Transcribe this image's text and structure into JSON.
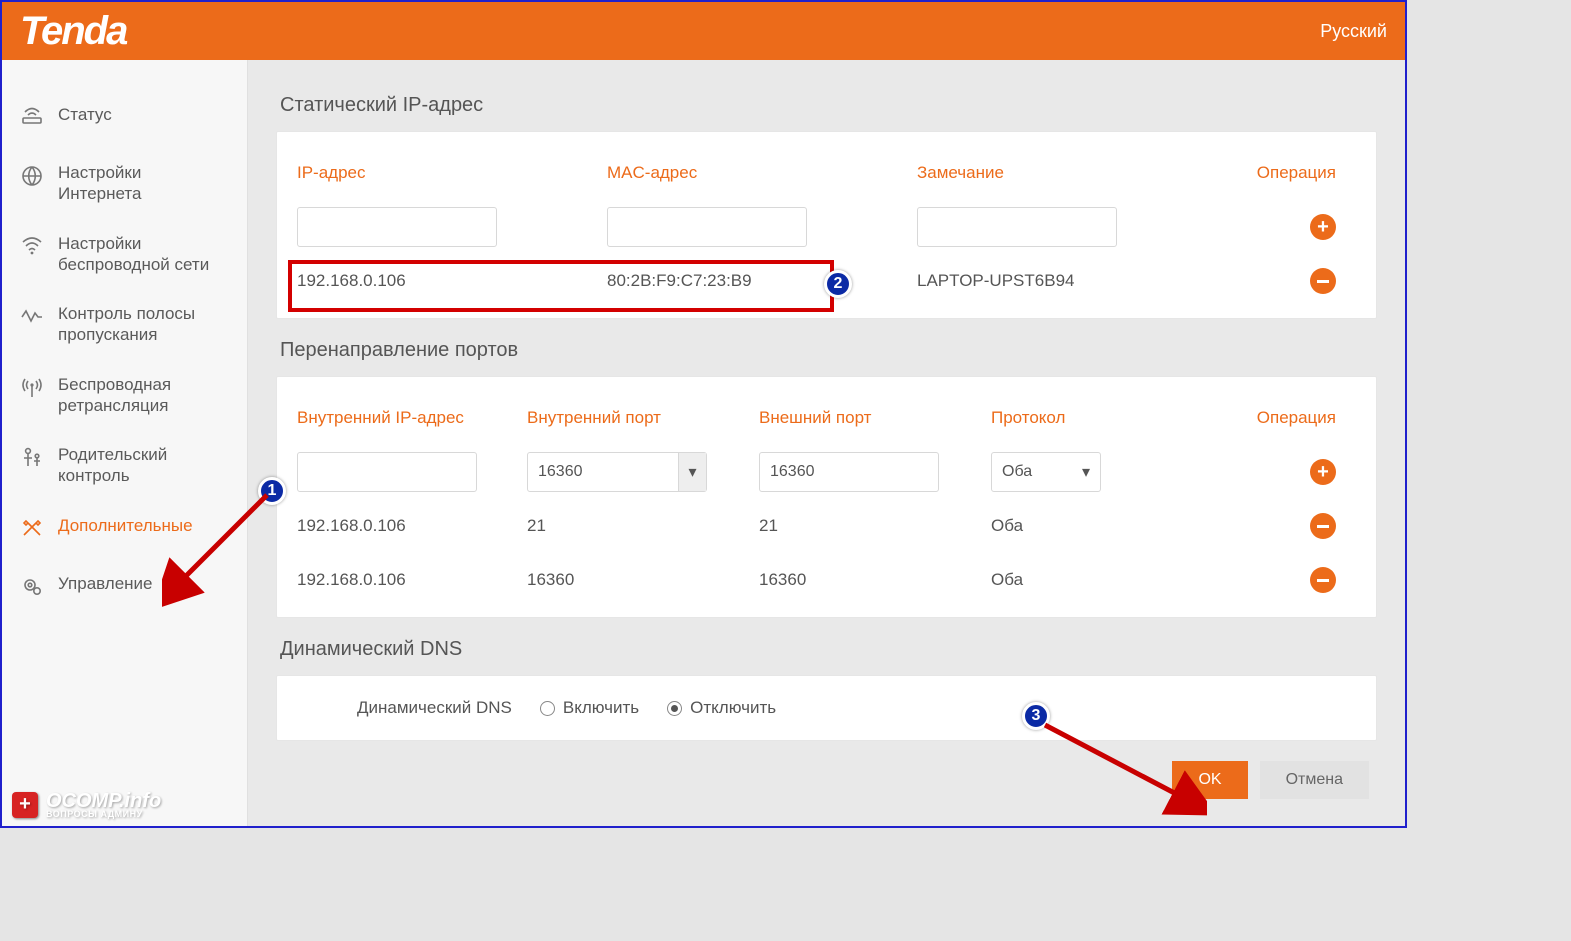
{
  "header": {
    "brand": "Tenda",
    "language": "Русский"
  },
  "sidebar": {
    "items": [
      {
        "label": "Статус"
      },
      {
        "label": "Настройки Интернета"
      },
      {
        "label": "Настройки беспроводной сети"
      },
      {
        "label": "Контроль полосы пропускания"
      },
      {
        "label": "Беспроводная ретрансляция"
      },
      {
        "label": "Родительский контроль"
      },
      {
        "label": "Дополнительные"
      },
      {
        "label": "Управление"
      }
    ]
  },
  "static_ip": {
    "title": "Статический IP-адрес",
    "headers": {
      "ip": "IP-адрес",
      "mac": "MAC-адрес",
      "note": "Замечание",
      "op": "Операция"
    },
    "rows": [
      {
        "ip": "192.168.0.106",
        "mac": "80:2B:F9:C7:23:B9",
        "note": "LAPTOP-UPST6B94"
      }
    ]
  },
  "port_forward": {
    "title": "Перенаправление портов",
    "headers": {
      "ip": "Внутренний IP-адрес",
      "iport": "Внутренний порт",
      "eport": "Внешний порт",
      "proto": "Протокол",
      "op": "Операция"
    },
    "input": {
      "iport": "16360",
      "eport": "16360",
      "proto": "Оба"
    },
    "rows": [
      {
        "ip": "192.168.0.106",
        "iport": "21",
        "eport": "21",
        "proto": "Оба"
      },
      {
        "ip": "192.168.0.106",
        "iport": "16360",
        "eport": "16360",
        "proto": "Оба"
      }
    ]
  },
  "ddns": {
    "title": "Динамический DNS",
    "label": "Динамический DNS",
    "enable": "Включить",
    "disable": "Отключить",
    "value": "disable"
  },
  "buttons": {
    "ok": "OK",
    "cancel": "Отмена"
  },
  "annotations": {
    "c1": "1",
    "c2": "2",
    "c3": "3"
  },
  "watermark": {
    "title": "OCOMP.info",
    "subtitle": "ВОПРОСЫ АДМИНУ"
  }
}
